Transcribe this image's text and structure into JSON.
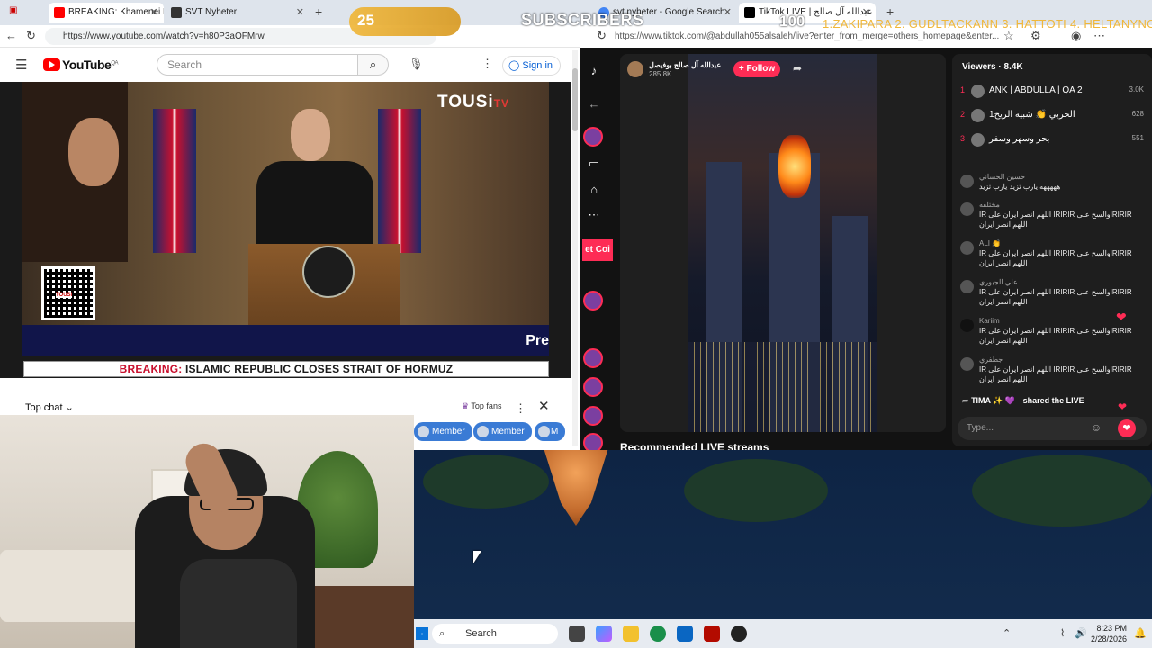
{
  "left_browser": {
    "tabs": [
      {
        "label": "BREAKING: Khamenei Rep",
        "active": true
      },
      {
        "label": "SVT Nyheter",
        "active": false
      }
    ],
    "url": "https://www.youtube.com/watch?v=h80P3aOFMrw"
  },
  "youtube": {
    "logo": "YouTube",
    "region": "QA",
    "search_placeholder": "Search",
    "sign_in": "Sign in",
    "channel_logo": "TOUSi",
    "channel_logo_suffix": "TV",
    "qr_label": "TOUSi",
    "preview_text": "Pre",
    "ticker_label": "BREAKING:",
    "ticker_text": "ISLAMIC REPUBLIC CLOSES STRAIT OF HORMUZ",
    "chat_title": "Top chat",
    "top_fans": "Top fans",
    "member_chips": [
      "Member",
      "Member",
      "M"
    ]
  },
  "right_browser": {
    "tabs": [
      {
        "label": "svt nyheter - Google Search"
      },
      {
        "label": "TikTok LIVE | عبدالله آل صالح"
      }
    ],
    "url": "https://www.tiktok.com/@abdullah055alsaleh/live?enter_from_merge=others_homepage&enter..."
  },
  "tiktok": {
    "host_name": "عبدالله آل صالح بوفيصل",
    "host_likes": "285.8K",
    "follow_label": "+ Follow",
    "coin_tag": "et Coi",
    "viewers_title": "Viewers · 8.4K",
    "top_viewers": [
      {
        "rank": "1",
        "name": "ANK | ABDULLA | QA 2",
        "score": "3.0K"
      },
      {
        "rank": "2",
        "name": "الحربي 👏 شبيه الريح1",
        "score": "628"
      },
      {
        "rank": "3",
        "name": "بحر وسهر وسفر",
        "score": "551"
      }
    ],
    "messages": [
      {
        "user": "حسين الحساني",
        "text": "هههههه يارب تزيد يارب تزيد"
      },
      {
        "user": "مختلفه",
        "text": "IR اللهم انصر ايران على IRIRIR والسح علىIRIRIR اللهم انصر ايران"
      },
      {
        "user": "ALI 👏",
        "text": "IR اللهم انصر ايران على IRIRIR والسح علىIRIRIR اللهم انصر ايران"
      },
      {
        "user": "علي الجبوري",
        "text": "IR اللهم انصر ايران على IRIRIR والسح علىIRIRIR اللهم انصر ايران"
      },
      {
        "user": "Kariim",
        "text": "IR اللهم انصر ايران على IRIRIR والسح علىIRIRIR اللهم انصر ايران"
      },
      {
        "user": "جطفري",
        "text": "IR اللهم انصر ايران على IRIRIR والسح علىIRIRIR اللهم انصر ايران"
      }
    ],
    "shared_user": "TIMA ✨ 💜",
    "shared_text": "shared the LIVE",
    "input_placeholder": "Type...",
    "recommended": "Recommended LIVE streams"
  },
  "overlay": {
    "sub_count": "25",
    "sub_label": "SUBSCRIBERS",
    "sub_goal": "100",
    "sub_list": "1.ZAKIPARA 2. GUDLTACKANN 3. HATTOTI 4. HELTANYNOR"
  },
  "taskbar": {
    "search_label": "Search",
    "time": "8:23 PM",
    "date": "2/28/2026"
  }
}
